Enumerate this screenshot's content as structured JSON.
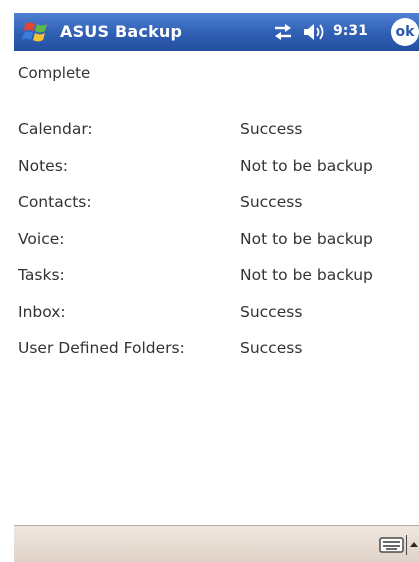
{
  "titlebar": {
    "start_icon": "windows-flag-icon",
    "app_title": "ASUS Backup",
    "sync_icon": "connectivity-arrows-icon",
    "volume_icon": "speaker-icon",
    "time": "9:31",
    "ok_label": "ok"
  },
  "content": {
    "status_heading": "Complete",
    "results": [
      {
        "item": "Calendar:",
        "status": "Success"
      },
      {
        "item": "Notes:",
        "status": "Not to be backup"
      },
      {
        "item": "Contacts:",
        "status": "Success"
      },
      {
        "item": "Voice:",
        "status": "Not to be backup"
      },
      {
        "item": "Tasks:",
        "status": "Not to be backup"
      },
      {
        "item": "Inbox:",
        "status": "Success"
      },
      {
        "item": "User Defined Folders:",
        "status": "Success"
      }
    ]
  },
  "menubar": {
    "sip_icon": "keyboard-icon",
    "sip_arrow_icon": "up-arrow-icon"
  },
  "colors": {
    "titlebar": "#2f5fb3",
    "menubar": "#e8ddd4",
    "text": "#333333"
  }
}
